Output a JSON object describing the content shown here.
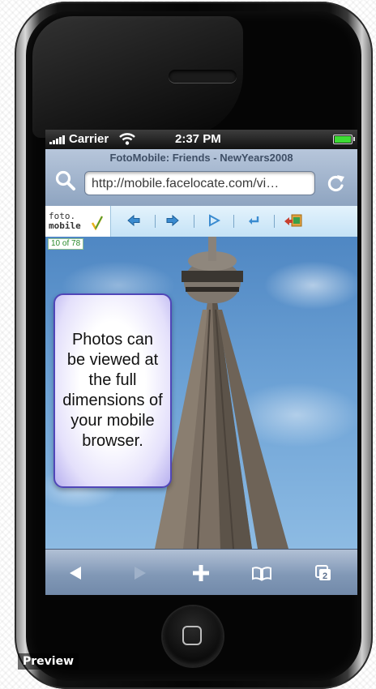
{
  "status_bar": {
    "carrier": "Carrier",
    "time": "2:37 PM",
    "battery_level": 1.0
  },
  "browser": {
    "page_title": "FotoMobile: Friends - NewYears2008",
    "url": "http://mobile.facelocate.com/vi…",
    "search_icon": "search-icon",
    "reload_icon": "reload-icon"
  },
  "fotomobile_toolbar": {
    "logo_line1": "foto.",
    "logo_line2": "mobile",
    "buttons": [
      "back-arrow-icon",
      "forward-arrow-icon",
      "play-icon",
      "return-icon",
      "exit-icon"
    ]
  },
  "photo": {
    "counter": "10 of 78",
    "callout": "Photos can be viewed at the full dimensions of your mobile browser."
  },
  "bottom_toolbar": {
    "buttons": [
      "back-icon",
      "forward-icon",
      "add-bookmark-icon",
      "bookmarks-icon",
      "pages-icon"
    ],
    "pages_count": "2"
  },
  "overlay": {
    "preview_label": "Preview"
  },
  "colors": {
    "toolbar_blue": "#c4e2f6",
    "callout_border": "#5046b8",
    "battery_green": "#3ddc34"
  }
}
